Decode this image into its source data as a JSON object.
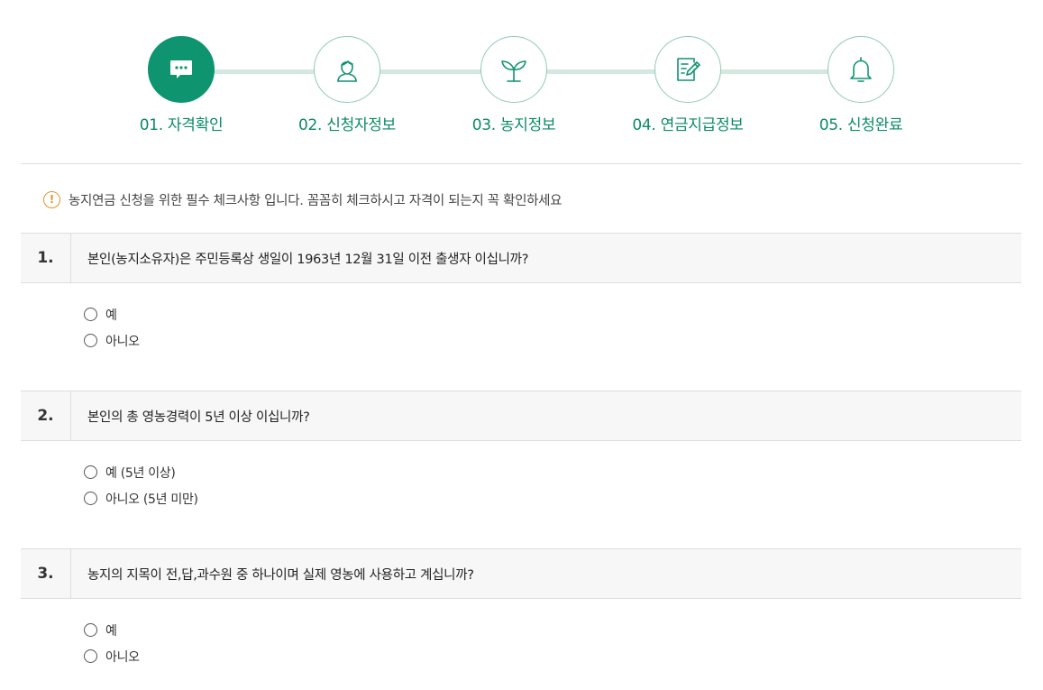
{
  "stepper": {
    "steps": [
      {
        "label": "01. 자격확인",
        "icon": "chat-bubble-icon",
        "active": true
      },
      {
        "label": "02. 신청자정보",
        "icon": "user-icon",
        "active": false
      },
      {
        "label": "03. 농지정보",
        "icon": "sprout-icon",
        "active": false
      },
      {
        "label": "04. 연금지급정보",
        "icon": "document-pen-icon",
        "active": false
      },
      {
        "label": "05. 신청완료",
        "icon": "bell-icon",
        "active": false
      }
    ]
  },
  "notice": {
    "icon": "exclamation-circle-icon",
    "text": "농지연금 신청을 위한 필수 체크사항 입니다. 꼼꼼히 체크하시고 자격이 되는지 꼭 확인하세요"
  },
  "questions": [
    {
      "number": "1.",
      "text": "본인(농지소유자)은 주민등록상 생일이 1963년 12월 31일 이전 출생자 이십니까?",
      "options": [
        "예",
        "아니오"
      ]
    },
    {
      "number": "2.",
      "text": "본인의 총 영농경력이 5년 이상 이십니까?",
      "options": [
        "예 (5년 이상)",
        "아니오 (5년 미만)"
      ]
    },
    {
      "number": "3.",
      "text": "농지의 지목이 전,답,과수원 중 하나이며 실제 영농에 사용하고 계십니까?",
      "options": [
        "예",
        "아니오"
      ]
    }
  ],
  "colors": {
    "accent": "#0f9470",
    "step_line": "#d3e9e0",
    "step_border": "#8fcab3",
    "warning": "#e2932c"
  }
}
